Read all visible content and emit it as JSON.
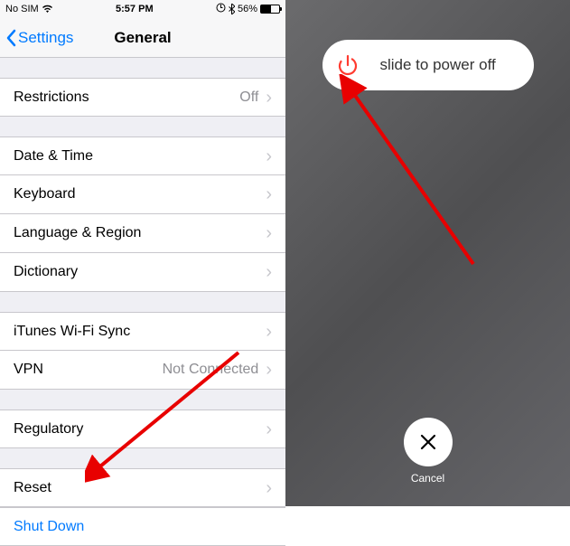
{
  "status": {
    "carrier": "No SIM",
    "time": "5:57 PM",
    "battery_pct": "56%"
  },
  "nav": {
    "back_label": "Settings",
    "title": "General"
  },
  "groups": [
    {
      "cells": [
        {
          "label": "Restrictions",
          "value": "Off"
        }
      ]
    },
    {
      "cells": [
        {
          "label": "Date & Time"
        },
        {
          "label": "Keyboard"
        },
        {
          "label": "Language & Region"
        },
        {
          "label": "Dictionary"
        }
      ]
    },
    {
      "cells": [
        {
          "label": "iTunes Wi-Fi Sync"
        },
        {
          "label": "VPN",
          "value": "Not Connected"
        }
      ]
    },
    {
      "cells": [
        {
          "label": "Regulatory"
        }
      ]
    },
    {
      "cells": [
        {
          "label": "Reset"
        }
      ]
    }
  ],
  "action": {
    "shutdown": "Shut Down"
  },
  "power": {
    "slide_label": "slide to power off",
    "cancel_label": "Cancel"
  },
  "colors": {
    "accent": "#007aff",
    "danger": "#ff3b30",
    "arrow": "#e80000"
  }
}
